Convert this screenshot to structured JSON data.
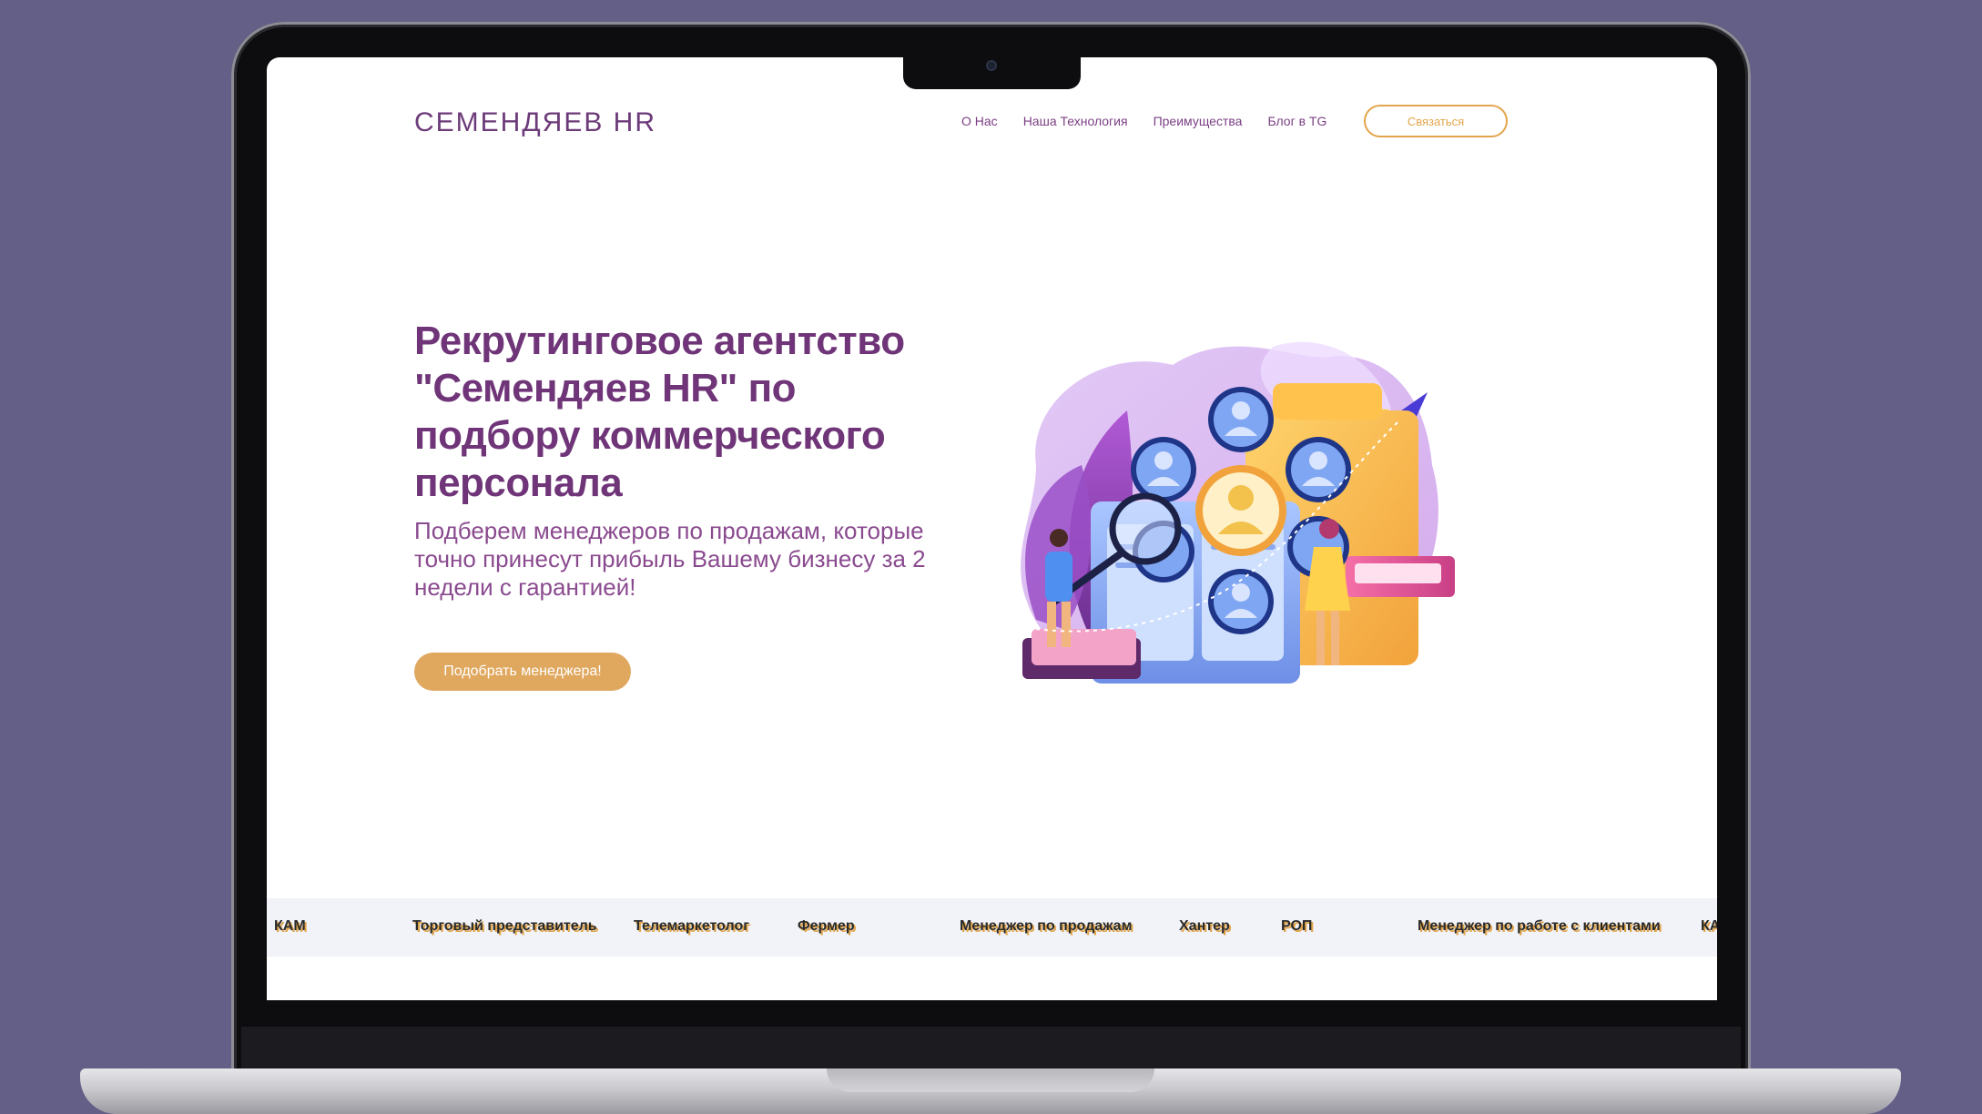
{
  "site": {
    "logo": "СЕМЕНДЯЕВ HR",
    "nav": [
      "О Нас",
      "Наша Технология",
      "Преимущества",
      "Блог в TG"
    ],
    "contact_button": "Связаться"
  },
  "hero": {
    "title": "Рекрутинговое агентство \"Семендяев HR\" по подбору коммерческого персонала",
    "subtitle": "Подберем менеджеров по продажам, которые точно принесут прибыль Вашему бизнесу за 2 недели с гарантией!",
    "cta_button": "Подобрать менеджера!"
  },
  "ticker": {
    "items": [
      "КАМ",
      "Торговый представитель",
      "Телемаркетолог",
      "Фермер",
      "Менеджер по продажам",
      "Хантер",
      "РОП",
      "Менеджер по работе с клиентами",
      "КА"
    ]
  },
  "colors": {
    "background": "#635f87",
    "brand_purple": "#6f3578",
    "accent_orange": "#e0a85f"
  },
  "icons": {
    "camera": "camera-icon",
    "illustration": "recruiting-illustration"
  }
}
